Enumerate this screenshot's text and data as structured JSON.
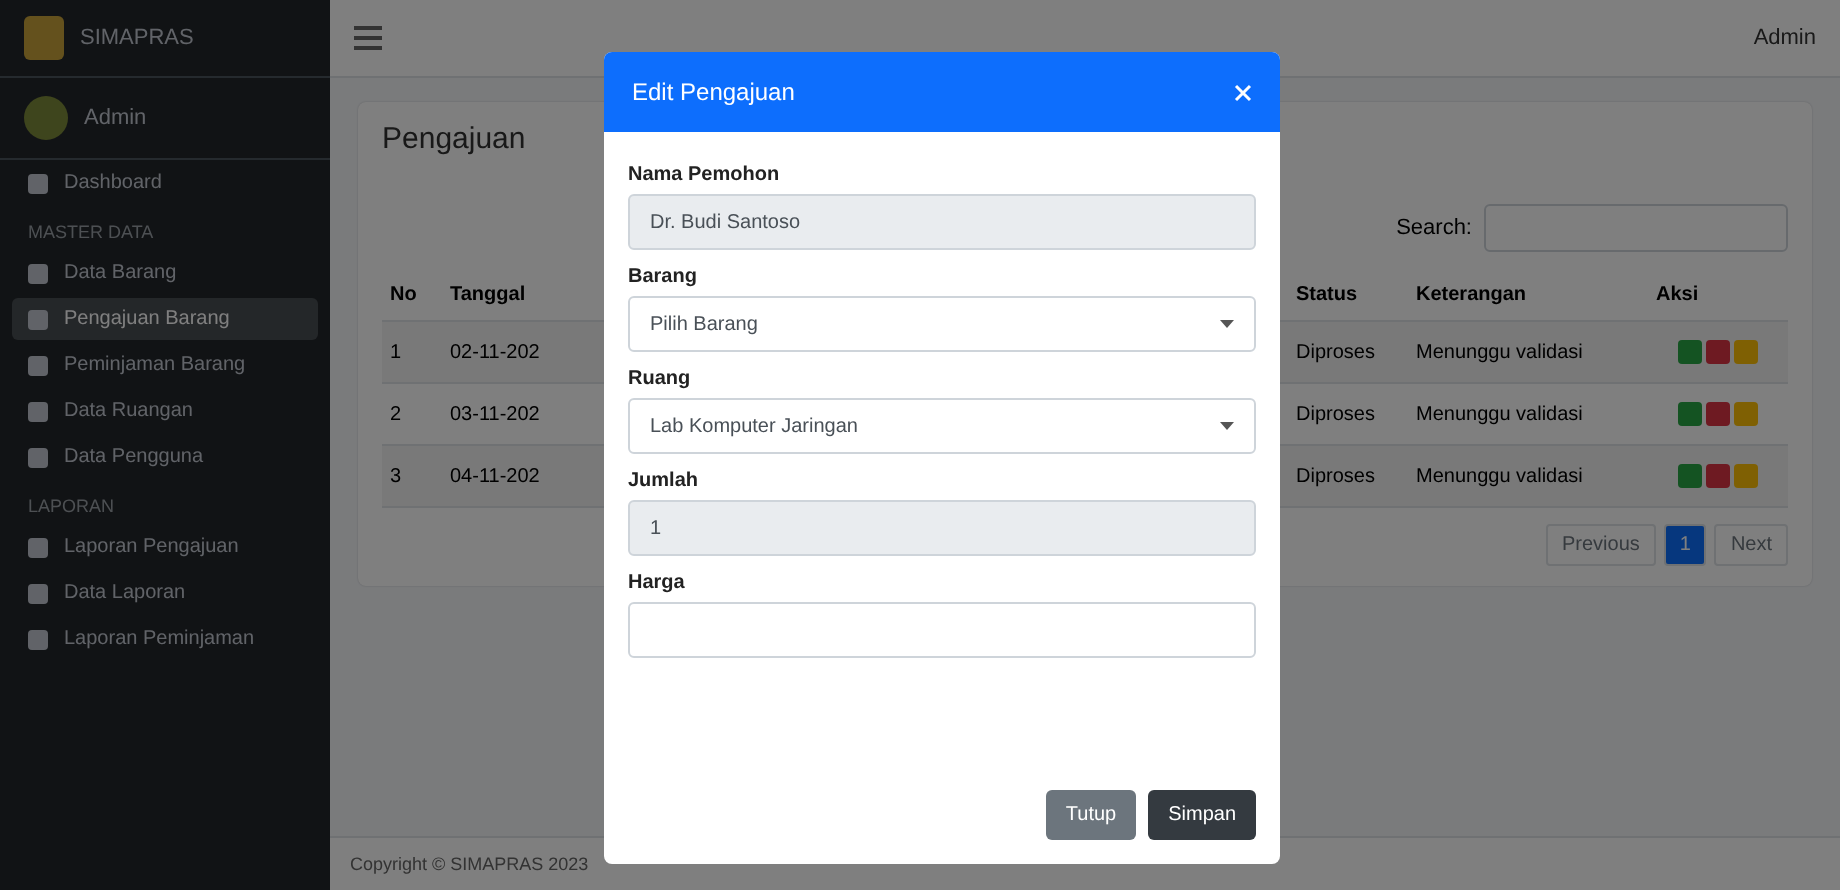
{
  "sidebar": {
    "brand": "SIMAPRAS",
    "user": "Admin",
    "sections": [
      {
        "items": [
          {
            "label": "Dashboard",
            "selected": false
          }
        ]
      },
      {
        "heading": "MASTER DATA",
        "items": [
          {
            "label": "Data Barang",
            "selected": false
          },
          {
            "label": "Pengajuan Barang",
            "selected": true
          },
          {
            "label": "Peminjaman Barang",
            "selected": false
          },
          {
            "label": "Data Ruangan",
            "selected": false
          },
          {
            "label": "Data Pengguna",
            "selected": false
          }
        ]
      },
      {
        "heading": "LAPORAN",
        "items": [
          {
            "label": "Laporan Pengajuan",
            "selected": false
          },
          {
            "label": "Data Laporan",
            "selected": false
          },
          {
            "label": "Laporan Peminjaman",
            "selected": false
          }
        ]
      }
    ]
  },
  "topbar": {
    "user": "Admin"
  },
  "page": {
    "title": "Pengajuan",
    "search_label": "Search:",
    "table": {
      "columns": [
        "No",
        "Tanggal",
        "Status",
        "Keterangan",
        "Aksi"
      ],
      "rows": [
        {
          "no": "1",
          "date": "02-11-202",
          "status": "Diproses",
          "note": "Menunggu validasi"
        },
        {
          "no": "2",
          "date": "03-11-202",
          "status": "Diproses",
          "note": "Menunggu validasi"
        },
        {
          "no": "3",
          "date": "04-11-202",
          "status": "Diproses",
          "note": "Menunggu validasi"
        }
      ]
    },
    "pagination": [
      {
        "label": "Previous",
        "selected": false
      },
      {
        "label": "1",
        "selected": true
      },
      {
        "label": "Next",
        "selected": false
      }
    ],
    "footer": "Copyright © SIMAPRAS 2023"
  },
  "modal": {
    "title": "Edit Pengajuan",
    "fields": [
      {
        "kind": "readonly",
        "label": "Nama Pemohon",
        "value": "Dr. Budi Santoso"
      },
      {
        "kind": "select",
        "label": "Barang",
        "value": "Pilih Barang"
      },
      {
        "kind": "select",
        "label": "Ruang",
        "value": "Lab Komputer Jaringan"
      },
      {
        "kind": "readonly",
        "label": "Jumlah",
        "value": "1"
      },
      {
        "kind": "text",
        "label": "Harga"
      }
    ],
    "buttons": [
      {
        "label": "Tutup",
        "kind": "secondary"
      },
      {
        "label": "Simpan",
        "kind": "dark"
      }
    ]
  }
}
